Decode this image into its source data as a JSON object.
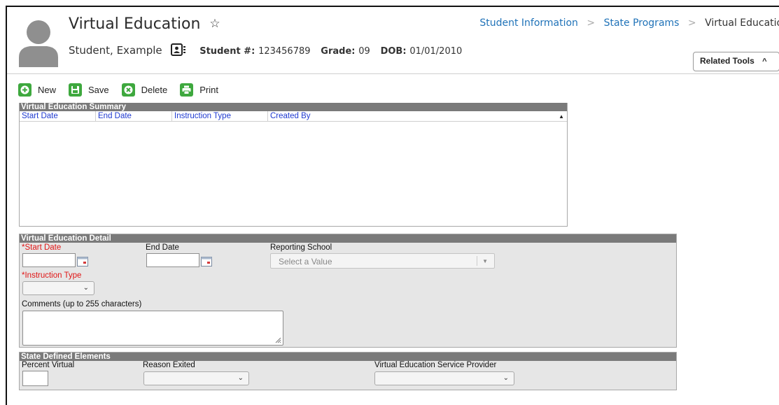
{
  "header": {
    "title": "Virtual Education",
    "student_name": "Student, Example",
    "student_num_label": "Student #:",
    "student_num": "123456789",
    "grade_label": "Grade:",
    "grade": "09",
    "dob_label": "DOB:",
    "dob": "01/01/2010",
    "related_tools": "Related Tools"
  },
  "breadcrumb": {
    "items": [
      "Student Information",
      "State Programs",
      "Virtual Education"
    ]
  },
  "toolbar": {
    "new_label": "New",
    "save_label": "Save",
    "delete_label": "Delete",
    "print_label": "Print"
  },
  "summary": {
    "title": "Virtual Education Summary",
    "columns": [
      "Start Date",
      "End Date",
      "Instruction Type",
      "Created By"
    ],
    "rows": []
  },
  "detail": {
    "title": "Virtual Education Detail",
    "start_date_label": "*Start Date",
    "start_date_value": "",
    "end_date_label": "End Date",
    "end_date_value": "",
    "reporting_school_label": "Reporting School",
    "reporting_school_placeholder": "Select a Value",
    "instruction_type_label": "*Instruction Type",
    "instruction_type_value": "",
    "comments_label": "Comments (up to 255 characters)",
    "comments_value": ""
  },
  "state": {
    "title": "State Defined Elements",
    "percent_virtual_label": "Percent Virtual",
    "percent_virtual_value": "",
    "reason_exited_label": "Reason Exited",
    "reason_exited_value": "",
    "provider_label": "Virtual Education Service Provider",
    "provider_value": ""
  },
  "colors": {
    "link": "#1f72b8",
    "required": "#e01515",
    "toolbar_icon": "#3ea83e",
    "section_header": "#7a7a7a",
    "grid_header_text": "#1f3ad0",
    "panel_bg": "#e6e6e6"
  },
  "icons": {
    "star": "star-outline-icon",
    "student_card": "id-card-icon",
    "new": "plus-circle-icon",
    "save": "floppy-disk-icon",
    "delete": "x-circle-icon",
    "print": "printer-icon",
    "calendar": "calendar-icon",
    "chevron": "chevron-down-icon"
  }
}
